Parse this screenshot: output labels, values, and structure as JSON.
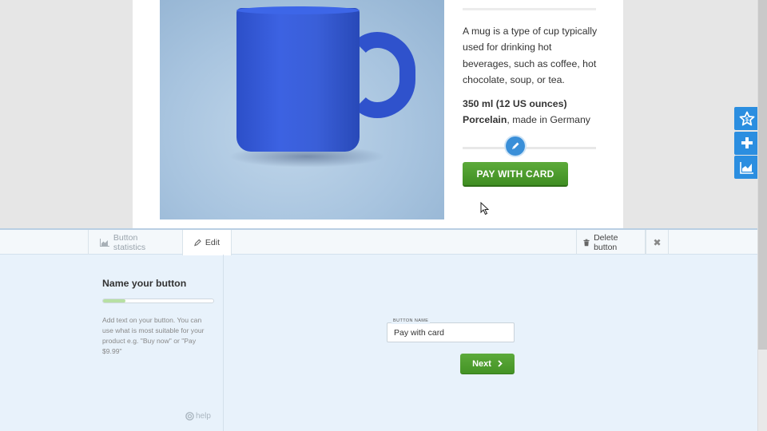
{
  "product": {
    "description": "A mug is a type of cup typically used for drinking hot beverages, such as coffee, hot chocolate, soup, or tea.",
    "volume": "350 ml (12 US ounces)",
    "material_bold": "Porcelain",
    "material_rest": ", made in Germany",
    "pay_button_label": "PAY WITH CARD"
  },
  "side_tools": [
    "star-dollar-icon",
    "plus-icon",
    "area-chart-icon"
  ],
  "editor": {
    "tabs": {
      "statistics_label": "Button statistics",
      "edit_label": "Edit",
      "delete_label": "Delete button",
      "close_glyph": "✖"
    },
    "step": {
      "title": "Name your button",
      "progress": 0.2,
      "help_text": "Add text on your button. You can use what is most suitable for your product e.g. \"Buy now\" or \"Pay $9.99\"",
      "help_link": "help"
    },
    "field": {
      "label": "BUTTON NAME",
      "value": "Pay with card"
    },
    "next_label": "Next"
  },
  "colors": {
    "accent_blue": "#2b8ee0",
    "green_button": "#4a9a2a",
    "panel_bg": "#e8f2fb"
  }
}
